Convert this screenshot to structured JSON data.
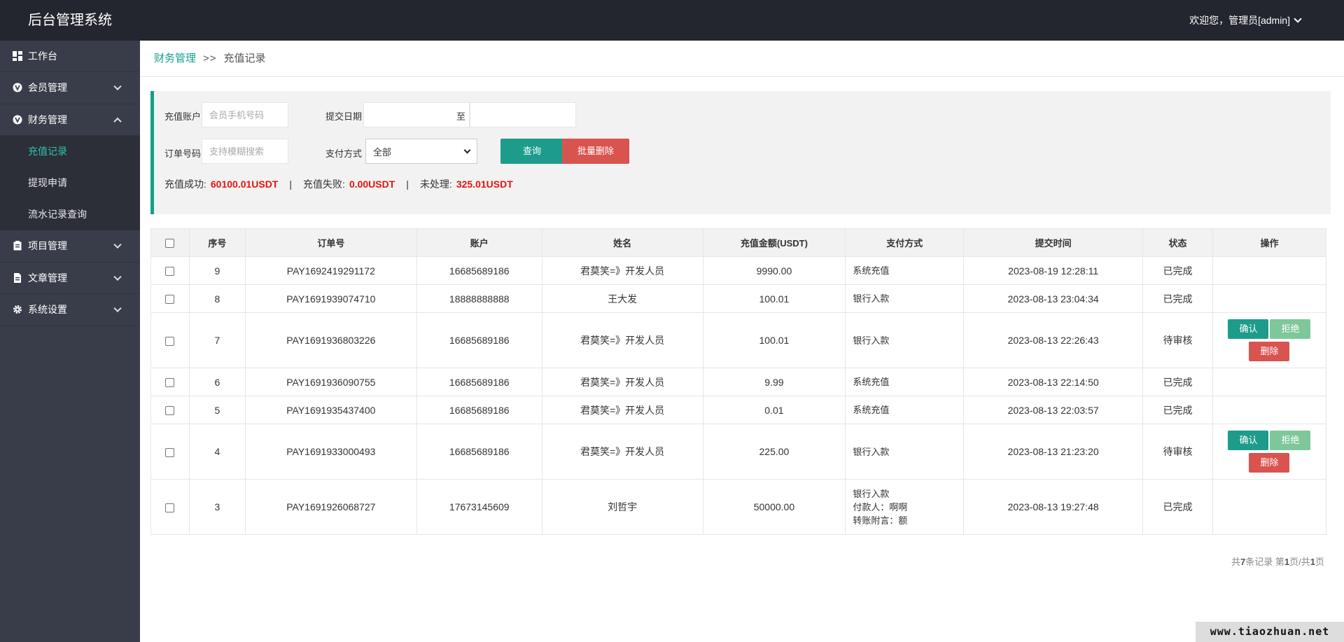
{
  "header": {
    "logo": "后台管理系统",
    "user": "欢迎您，管理员[admin]"
  },
  "sidebar": {
    "items": [
      {
        "label": "工作台",
        "icon": "dashboard-icon",
        "expandable": false
      },
      {
        "label": "会员管理",
        "icon": "vip-icon",
        "expandable": true
      },
      {
        "label": "财务管理",
        "icon": "vip-icon",
        "expandable": true,
        "expanded": true,
        "children": [
          "充值记录",
          "提现申请",
          "流水记录查询"
        ],
        "active_child": 0
      },
      {
        "label": "项目管理",
        "icon": "clipboard-icon",
        "expandable": true
      },
      {
        "label": "文章管理",
        "icon": "document-icon",
        "expandable": true
      },
      {
        "label": "系统设置",
        "icon": "gear-icon",
        "expandable": true
      }
    ]
  },
  "breadcrumb": {
    "parent": "财务管理",
    "separator": ">>",
    "current": "充值记录"
  },
  "filter": {
    "account_label": "充值账户",
    "account_placeholder": "会员手机号码",
    "date_label": "提交日期",
    "date_to": "至",
    "order_label": "订单号码",
    "order_placeholder": "支持模糊搜索",
    "pay_label": "支付方式",
    "pay_value": "全部",
    "query_button": "查询",
    "batch_delete_button": "批量删除"
  },
  "summary": {
    "success_label": "充值成功:",
    "success_value": "60100.01USDT",
    "fail_label": "充值失败:",
    "fail_value": "0.00USDT",
    "pending_label": "未处理:",
    "pending_value": "325.01USDT",
    "divider": "|"
  },
  "table": {
    "headers": [
      "序号",
      "订单号",
      "账户",
      "姓名",
      "充值金额(USDT)",
      "支付方式",
      "提交时间",
      "状态",
      "操作"
    ],
    "rows": [
      {
        "id": "9",
        "order": "PAY1692419291172",
        "account": "16685689186",
        "name": "君莫笑=》开发人员",
        "amount": "9990.00",
        "pay": [
          "系统充值"
        ],
        "time": "2023-08-19 12:28:11",
        "status": "已完成",
        "actions": false
      },
      {
        "id": "8",
        "order": "PAY1691939074710",
        "account": "18888888888",
        "name": "王大发",
        "amount": "100.01",
        "pay": [
          "银行入款"
        ],
        "time": "2023-08-13 23:04:34",
        "status": "已完成",
        "actions": false
      },
      {
        "id": "7",
        "order": "PAY1691936803226",
        "account": "16685689186",
        "name": "君莫笑=》开发人员",
        "amount": "100.01",
        "pay": [
          "银行入款"
        ],
        "time": "2023-08-13 22:26:43",
        "status": "待审核",
        "actions": true
      },
      {
        "id": "6",
        "order": "PAY1691936090755",
        "account": "16685689186",
        "name": "君莫笑=》开发人员",
        "amount": "9.99",
        "pay": [
          "系统充值"
        ],
        "time": "2023-08-13 22:14:50",
        "status": "已完成",
        "actions": false
      },
      {
        "id": "5",
        "order": "PAY1691935437400",
        "account": "16685689186",
        "name": "君莫笑=》开发人员",
        "amount": "0.01",
        "pay": [
          "系统充值"
        ],
        "time": "2023-08-13 22:03:57",
        "status": "已完成",
        "actions": false
      },
      {
        "id": "4",
        "order": "PAY1691933000493",
        "account": "16685689186",
        "name": "君莫笑=》开发人员",
        "amount": "225.00",
        "pay": [
          "银行入款"
        ],
        "time": "2023-08-13 21:23:20",
        "status": "待审核",
        "actions": true
      },
      {
        "id": "3",
        "order": "PAY1691926068727",
        "account": "17673145609",
        "name": "刘哲宇",
        "amount": "50000.00",
        "pay": [
          "银行入款",
          "付款人：啊啊",
          "转账附言：额"
        ],
        "time": "2023-08-13 19:27:48",
        "status": "已完成",
        "actions": false
      }
    ],
    "action_labels": {
      "confirm": "确认",
      "reject": "拒绝",
      "delete": "删除"
    }
  },
  "pager": {
    "p1": "共",
    "total": "7",
    "p2": "条记录 第",
    "page": "1",
    "p3": "页/共",
    "pages": "1",
    "p4": "页"
  },
  "watermark": "www.tiaozhuan.net"
}
